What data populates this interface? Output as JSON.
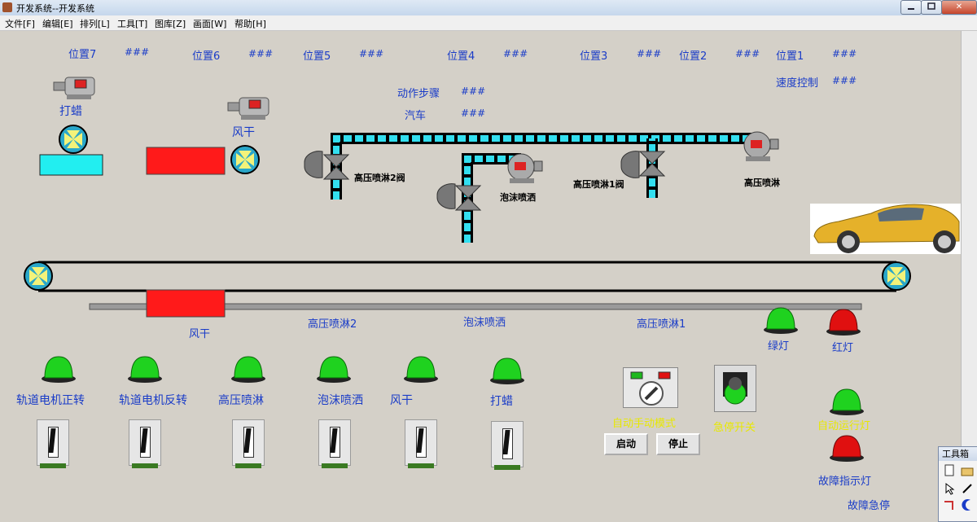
{
  "window": {
    "title": "开发系统--开发系统",
    "min_label": "",
    "max_label": "",
    "close_label": "✕"
  },
  "menu": [
    "文件[F]",
    "编辑[E]",
    "排列[L]",
    "工具[T]",
    "图库[Z]",
    "画面[W]",
    "帮助[H]"
  ],
  "positions": [
    {
      "label": "位置7",
      "value": "###"
    },
    {
      "label": "位置6",
      "value": "###"
    },
    {
      "label": "位置5",
      "value": "###"
    },
    {
      "label": "位置4",
      "value": "###"
    },
    {
      "label": "位置3",
      "value": "###"
    },
    {
      "label": "位置2",
      "value": "###"
    },
    {
      "label": "位置1",
      "value": "###"
    }
  ],
  "speed": {
    "label": "速度控制",
    "value": "###"
  },
  "action_step": {
    "label": "动作步骤",
    "value": "###"
  },
  "car": {
    "label": "汽车",
    "value": "###"
  },
  "equipment": {
    "wax_motor": "打蜡",
    "dry_motor": "风干",
    "hp_valve2": "高压喷淋2阀",
    "foam_pump": "泡沫喷洒",
    "hp_valve1": "高压喷淋1阀",
    "hp_pump": "高压喷淋"
  },
  "belt_labels": {
    "dry": "风干",
    "hp2": "高压喷淋2",
    "foam": "泡沫喷洒",
    "hp1": "高压喷淋1"
  },
  "status_lamps": {
    "green": "绿灯",
    "red": "红灯",
    "auto_run": "自动运行灯",
    "fault": "故障指示灯",
    "fault_stop": "故障急停"
  },
  "manual_switches": [
    "轨道电机正转",
    "轨道电机反转",
    "高压喷淋",
    "泡沫喷洒",
    "风干",
    "打蜡"
  ],
  "controls": {
    "mode_label": "自动手动模式",
    "start": "启动",
    "stop": "停止",
    "estop_label": "急停开关"
  },
  "toolbox": {
    "title": "工具箱"
  },
  "colors": {
    "pipe": "#33dff0",
    "label_blue": "#1a3cc8",
    "lamp_green": "#1fd21f",
    "lamp_red": "#e01010",
    "yellow_text": "#e8e800",
    "red_block": "#ff1a1a",
    "cyan_block": "#22eef0"
  }
}
